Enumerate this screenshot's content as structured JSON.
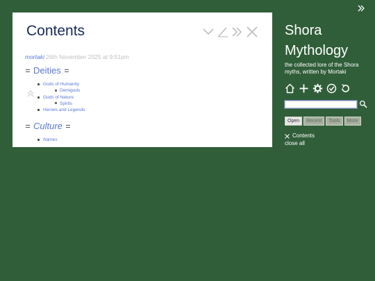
{
  "tiddler": {
    "title": "Contents",
    "modifier": "mortaki",
    "date": "26th November 2025 at 9:51pm",
    "sections": [
      {
        "heading": "Deities",
        "items": [
          {
            "label": "Gods of Humanity",
            "children": [
              "Demigods"
            ]
          },
          {
            "label": "Gods of Nature",
            "children": [
              "Spirits"
            ]
          },
          {
            "label": "Heroes and Legends",
            "children": []
          }
        ]
      },
      {
        "heading": "Culture",
        "items": [
          {
            "label": "Names",
            "children": []
          }
        ]
      }
    ],
    "controls": [
      "chevron-down-icon",
      "edit-icon",
      "fold-icon",
      "close-icon"
    ]
  },
  "sidebar": {
    "title_line1": "Shora",
    "title_line2": "Mythology",
    "subtitle": "the collected lore of the Shora myths, written by Mortaki",
    "page_controls": [
      "home-icon",
      "new-tiddler-icon",
      "settings-icon",
      "save-icon",
      "refresh-icon"
    ],
    "search": {
      "value": "",
      "placeholder": ""
    },
    "tabs": [
      "Open",
      "Recent",
      "Tools",
      "More"
    ],
    "active_tab": "Open",
    "open_items": [
      "Contents"
    ],
    "close_all": "close all"
  },
  "colors": {
    "background": "#305e39",
    "link": "#5778d8",
    "title": "#182955",
    "muted": "#c0c0c0"
  }
}
